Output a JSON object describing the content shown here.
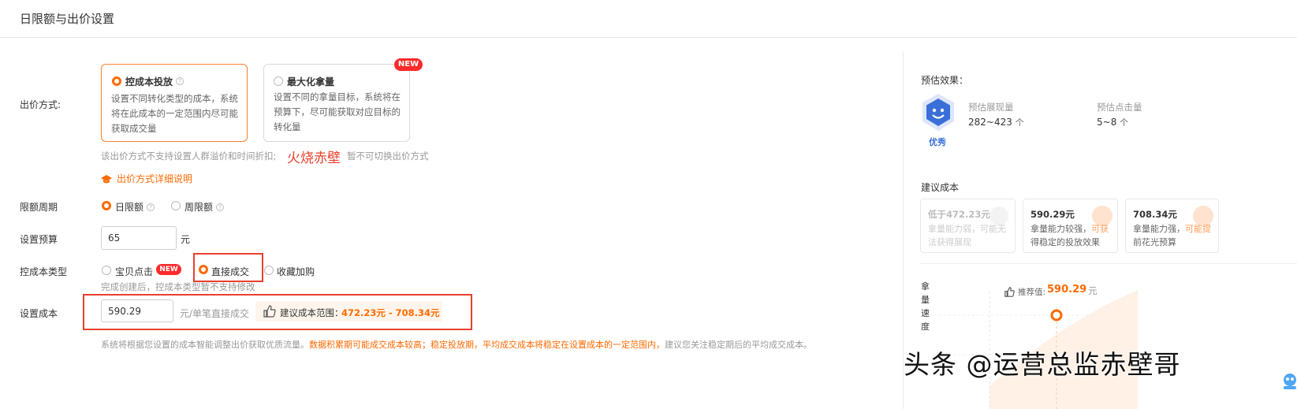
{
  "header": {
    "title": "日限额与出价设置"
  },
  "bid": {
    "label": "出价方式:",
    "option1": {
      "title": "控成本投放",
      "desc1": "设置不同转化类型的成本，系统",
      "desc2": "将在此成本的一定范围内尽可能",
      "desc3": "获取成交量"
    },
    "option2": {
      "title": "最大化拿量",
      "badge": "NEW",
      "desc1": "设置不同的拿量目标，系统将在",
      "desc2": "预算下，尽可能获取对应目标的",
      "desc3": "转化量"
    },
    "note": "该出价方式不支持设置人群溢价和时间折扣;",
    "note_tail": "暂不可切换出价方式",
    "watermark": "火烧赤壁",
    "detail_link": "出价方式详细说明"
  },
  "limit": {
    "label": "限额周期",
    "opt_day": "日限额",
    "opt_week": "周限额"
  },
  "budget": {
    "label": "设置预算",
    "value": "65",
    "unit": "元"
  },
  "cost_type": {
    "label": "控成本类型",
    "opt1": "宝贝点击",
    "opt1_badge": "NEW",
    "opt2": "直接成交",
    "opt3": "收藏加购",
    "note": "完成创建后，控成本类型暂不支持修改"
  },
  "cost": {
    "label": "设置成本",
    "value": "590.29",
    "unit": "元/单笔直接成交",
    "suggest_label": "建议成本范围：",
    "suggest_range": "472.23元 - 708.34元",
    "note_gray": "系统将根据您设置的成本智能调整出价获取优质流量。",
    "note_orange": "数据积累期可能成交成本较高；稳定投放期，平均成交成本将稳定在设置成本的一定范围内，",
    "note_gray2": "建议您关注稳定期后的平均成交成本。"
  },
  "estimate": {
    "title": "预估效果：",
    "rating": "优秀",
    "impressions_label": "预估展现量",
    "impressions_value": "282~423",
    "impressions_unit": "个",
    "clicks_label": "预估点击量",
    "clicks_value": "5~8",
    "clicks_unit": "个"
  },
  "recommend": {
    "title": "建议成本",
    "cards": [
      {
        "price": "低于472.23元",
        "desc1": "拿量能力弱，可能无",
        "desc1b": "",
        "desc2": "法获得展现"
      },
      {
        "price": "590.29元",
        "desc1": "拿量能力较强，",
        "desc1b": "可获",
        "desc2": "得稳定的投放效果"
      },
      {
        "price": "708.34元",
        "desc1": "拿量能力强，",
        "desc1b": "可能提",
        "desc2": "前花光预算"
      }
    ]
  },
  "chart": {
    "ylabel": [
      "拿",
      "量",
      "速",
      "度"
    ],
    "rec_label": "推荐值:",
    "rec_value": "590.29",
    "rec_unit": "元"
  },
  "overlay_watermark": "头条 @运营总监赤壁哥",
  "colors": {
    "accent": "#ff6a00",
    "red_box": "#e8412d",
    "badge": "#ff2a2a",
    "blue": "#3a6fd8"
  }
}
